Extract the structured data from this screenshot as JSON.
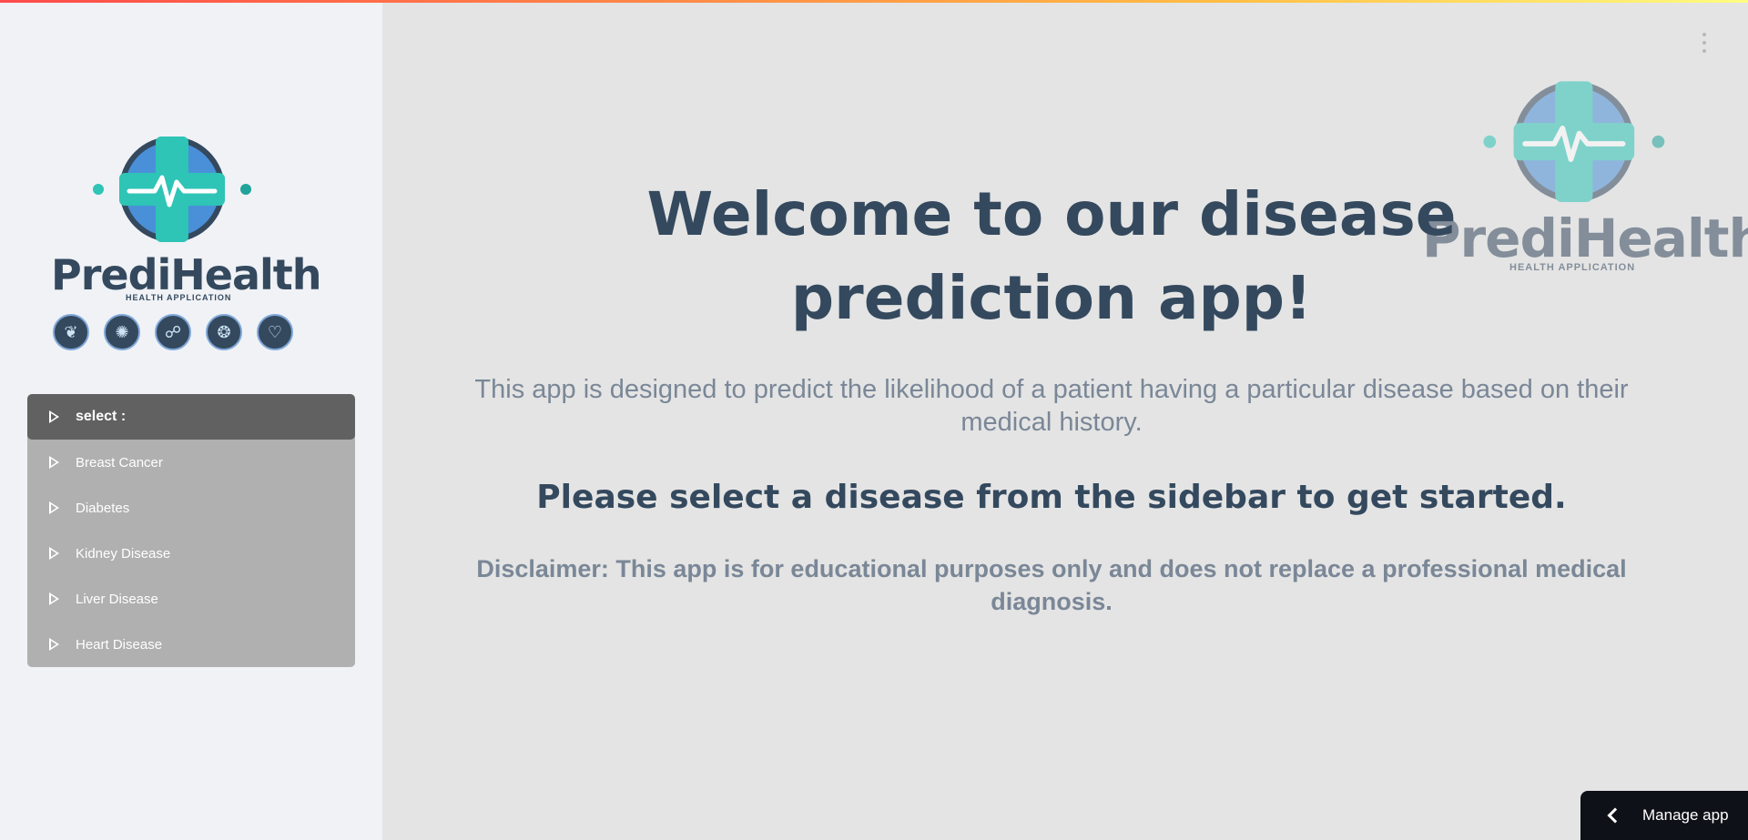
{
  "sidebar": {
    "logo": {
      "brand": "PrediHealth",
      "subtitle": "HEALTH APPLICATION"
    },
    "disease_icons": [
      "lungs-icon",
      "brain-icon",
      "ribbon-icon",
      "kidney-icon",
      "heart-icon"
    ],
    "menu": {
      "header": "select :",
      "items": [
        {
          "label": "Breast Cancer"
        },
        {
          "label": "Diabetes"
        },
        {
          "label": "Kidney Disease"
        },
        {
          "label": "Liver Disease"
        },
        {
          "label": "Heart Disease"
        }
      ]
    }
  },
  "main": {
    "logo": {
      "brand": "PrediHealth",
      "subtitle": "HEALTH APPLICATION"
    },
    "welcome_title": "Welcome to our disease prediction app!",
    "description": "This app is designed to predict the likelihood of a patient having a particular disease based on their medical history.",
    "select_message": "Please select a disease from the sidebar to get started.",
    "disclaimer": "Disclaimer: This app is for educational purposes only and does not replace a professional medical diagnosis."
  },
  "footer": {
    "manage_app_label": "Manage app"
  },
  "colors": {
    "accent_dark": "#34495e",
    "menu_header": "#616161",
    "menu_bg": "#b0b0b0",
    "teal": "#2ec4b6",
    "blue": "#4a90d9"
  }
}
